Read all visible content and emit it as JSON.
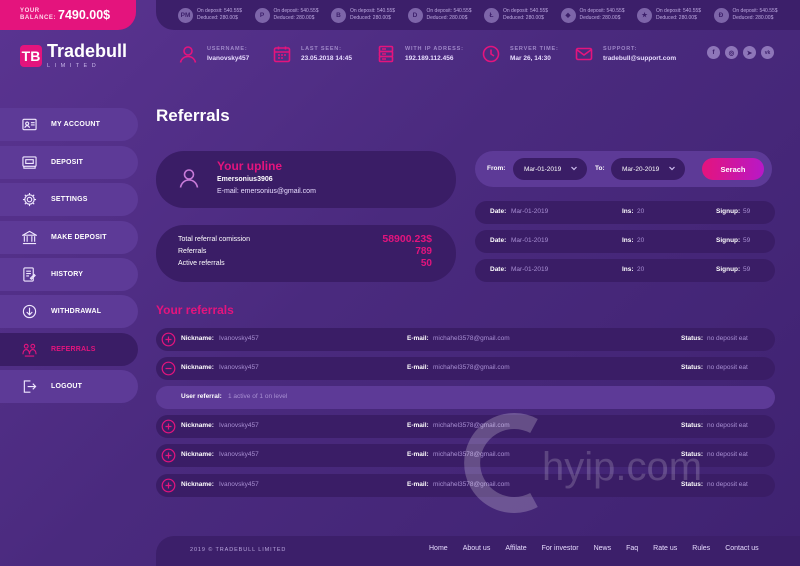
{
  "balance": {
    "label": "YOUR BALANCE:",
    "value": "7490.00$"
  },
  "ticker": [
    {
      "icon": "pm-icon",
      "glyph": "PM",
      "line1": "On deposit: 540.55$",
      "line2": "Deduced: 280.00$"
    },
    {
      "icon": "payeer-icon",
      "glyph": "P",
      "line1": "On deposit: 540.55$",
      "line2": "Deduced: 280.00$"
    },
    {
      "icon": "bitcoin-icon",
      "glyph": "B",
      "line1": "On deposit: 540.55$",
      "line2": "Deduced: 280.00$"
    },
    {
      "icon": "dash-icon",
      "glyph": "D",
      "line1": "On deposit: 540.55$",
      "line2": "Deduced: 280.00$"
    },
    {
      "icon": "litecoin-icon",
      "glyph": "Ł",
      "line1": "On deposit: 540.55$",
      "line2": "Deduced: 280.00$"
    },
    {
      "icon": "ethereum-icon",
      "glyph": "◆",
      "line1": "On deposit: 540.55$",
      "line2": "Deduced: 280.00$"
    },
    {
      "icon": "advcash-icon",
      "glyph": "★",
      "line1": "On deposit: 540.55$",
      "line2": "Deduced: 280.00$"
    },
    {
      "icon": "dogecoin-icon",
      "glyph": "Đ",
      "line1": "On deposit: 540.55$",
      "line2": "Deduced: 280.00$"
    }
  ],
  "brand": {
    "name": "Tradebull",
    "sub": "LIMITED",
    "mark": "TB"
  },
  "header": {
    "username": {
      "label": "USERNAME:",
      "value": "Ivanovsky457"
    },
    "last_seen": {
      "label": "LAST SEEN:",
      "value": "23.05.2018  14:45"
    },
    "ip": {
      "label": "WITH IP ADRESS:",
      "value": "192.189.112.456"
    },
    "server_time": {
      "label": "SERVER TIME:",
      "value": "Mar 26, 14:30"
    },
    "support": {
      "label": "SUPPORT:",
      "value": "tradebull@support.com"
    }
  },
  "socials": [
    "f",
    "◎",
    "➤",
    "vk"
  ],
  "sidebar": [
    {
      "label": "MY ACCOUNT",
      "icon": "id-card-icon"
    },
    {
      "label": "DEPOSIT",
      "icon": "deposit-icon"
    },
    {
      "label": "SETTINGS",
      "icon": "gear-icon"
    },
    {
      "label": "MAKE DEPOSIT",
      "icon": "bank-icon"
    },
    {
      "label": "HISTORY",
      "icon": "history-icon"
    },
    {
      "label": "WITHDRAWAL",
      "icon": "withdrawal-icon"
    },
    {
      "label": "REFERRALS",
      "icon": "referrals-icon",
      "active": true
    },
    {
      "label": "LOGOUT",
      "icon": "logout-icon"
    }
  ],
  "page": {
    "title": "Referrals"
  },
  "upline": {
    "title": "Your upline",
    "name": "Emersonius3906",
    "email": "E-mail: emersonius@gmail.com"
  },
  "stats": [
    {
      "label": "Total referral comission",
      "value": "58900.23$"
    },
    {
      "label": "Referrals",
      "value": "789"
    },
    {
      "label": "Active referrals",
      "value": "50"
    }
  ],
  "filter": {
    "from_label": "From:",
    "from_value": "Mar-01-2019",
    "to_label": "To:",
    "to_value": "Mar-20-2019",
    "search_label": "Serach"
  },
  "date_rows": [
    {
      "date_k": "Date:",
      "date_v": "Mar-01-2019",
      "ins_k": "Ins:",
      "ins_v": "20",
      "sign_k": "Signup:",
      "sign_v": "59"
    },
    {
      "date_k": "Date:",
      "date_v": "Mar-01-2019",
      "ins_k": "Ins:",
      "ins_v": "20",
      "sign_k": "Signup:",
      "sign_v": "59"
    },
    {
      "date_k": "Date:",
      "date_v": "Mar-01-2019",
      "ins_k": "Ins:",
      "ins_v": "20",
      "sign_k": "Signup:",
      "sign_v": "59"
    }
  ],
  "your_referrals": {
    "title": "Your referrals",
    "rows": [
      {
        "type": "plus",
        "nick_k": "Nickname:",
        "nick_v": "Ivanovsky457",
        "mail_k": "E-mail:",
        "mail_v": "michahel3578@gmail.com",
        "status_k": "Status:",
        "status_v": "no deposit eat"
      },
      {
        "type": "minus",
        "nick_k": "Nickname:",
        "nick_v": "Ivanovsky457",
        "mail_k": "E-mail:",
        "mail_v": "michahel3578@gmail.com",
        "status_k": "Status:",
        "status_v": "no deposit eat"
      },
      {
        "type": "sub",
        "k": "User referral:",
        "v": "1 active of 1 on level"
      },
      {
        "type": "plus",
        "nick_k": "Nickname:",
        "nick_v": "Ivanovsky457",
        "mail_k": "E-mail:",
        "mail_v": "michahel3578@gmail.com",
        "status_k": "Status:",
        "status_v": "no deposit eat"
      },
      {
        "type": "plus",
        "nick_k": "Nickname:",
        "nick_v": "Ivanovsky457",
        "mail_k": "E-mail:",
        "mail_v": "michahel3578@gmail.com",
        "status_k": "Status:",
        "status_v": "no deposit eat"
      },
      {
        "type": "plus",
        "nick_k": "Nickname:",
        "nick_v": "Ivanovsky457",
        "mail_k": "E-mail:",
        "mail_v": "michahel3578@gmail.com",
        "status_k": "Status:",
        "status_v": "no deposit eat"
      }
    ]
  },
  "watermark": {
    "text": "hyip.com"
  },
  "footer": {
    "copyright": "2019 © TRADEBULL LIMITED",
    "links": [
      "Home",
      "About us",
      "Affilate",
      "For investor",
      "News",
      "Faq",
      "Rate us",
      "Rules",
      "Contact us"
    ]
  },
  "colors": {
    "accent": "#e4147d",
    "bg": "#4b2a7e",
    "card": "#3a1d66",
    "panel": "#5d3a97"
  }
}
